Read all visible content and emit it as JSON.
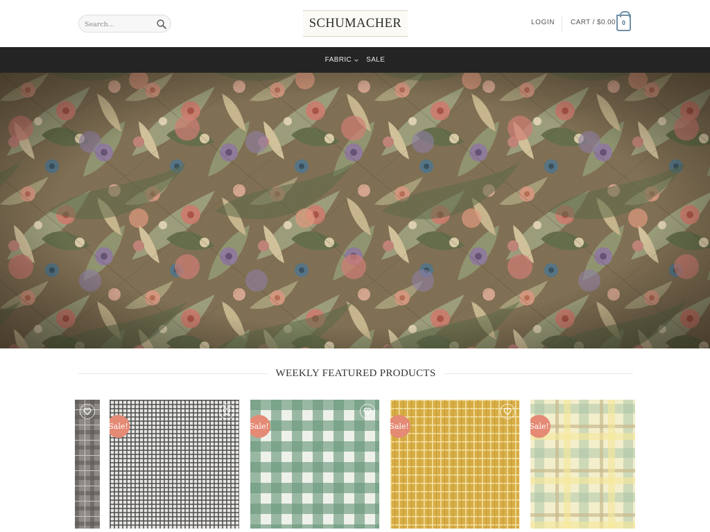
{
  "header": {
    "search_placeholder": "Search...",
    "logo": "SCHUMACHER",
    "login": "LOGIN",
    "cart": "CART / $0.00",
    "cart_count": "0"
  },
  "nav": {
    "items": [
      {
        "label": "FABRIC",
        "has_dropdown": true
      },
      {
        "label": "SALE",
        "has_dropdown": false
      }
    ]
  },
  "section": {
    "title": "WEEKLY FEATURED PRODUCTS"
  },
  "products": [
    {
      "pattern": "grey-plaid",
      "sale_label": "",
      "wishlist": "heart-icon"
    },
    {
      "pattern": "fine-black-white-check",
      "sale_label": "Sale!",
      "wishlist": "heart-icon"
    },
    {
      "pattern": "green-gingham",
      "sale_label": "Sale!",
      "wishlist": "heart-icon"
    },
    {
      "pattern": "mustard-grid",
      "sale_label": "Sale!",
      "wishlist": "heart-icon"
    },
    {
      "pattern": "pastel-plaid",
      "sale_label": "Sale!",
      "wishlist": "heart-icon"
    }
  ],
  "colors": {
    "navbar": "#242424",
    "sale_badge": "#e48a75",
    "cart_accent": "#6e8fa5"
  }
}
